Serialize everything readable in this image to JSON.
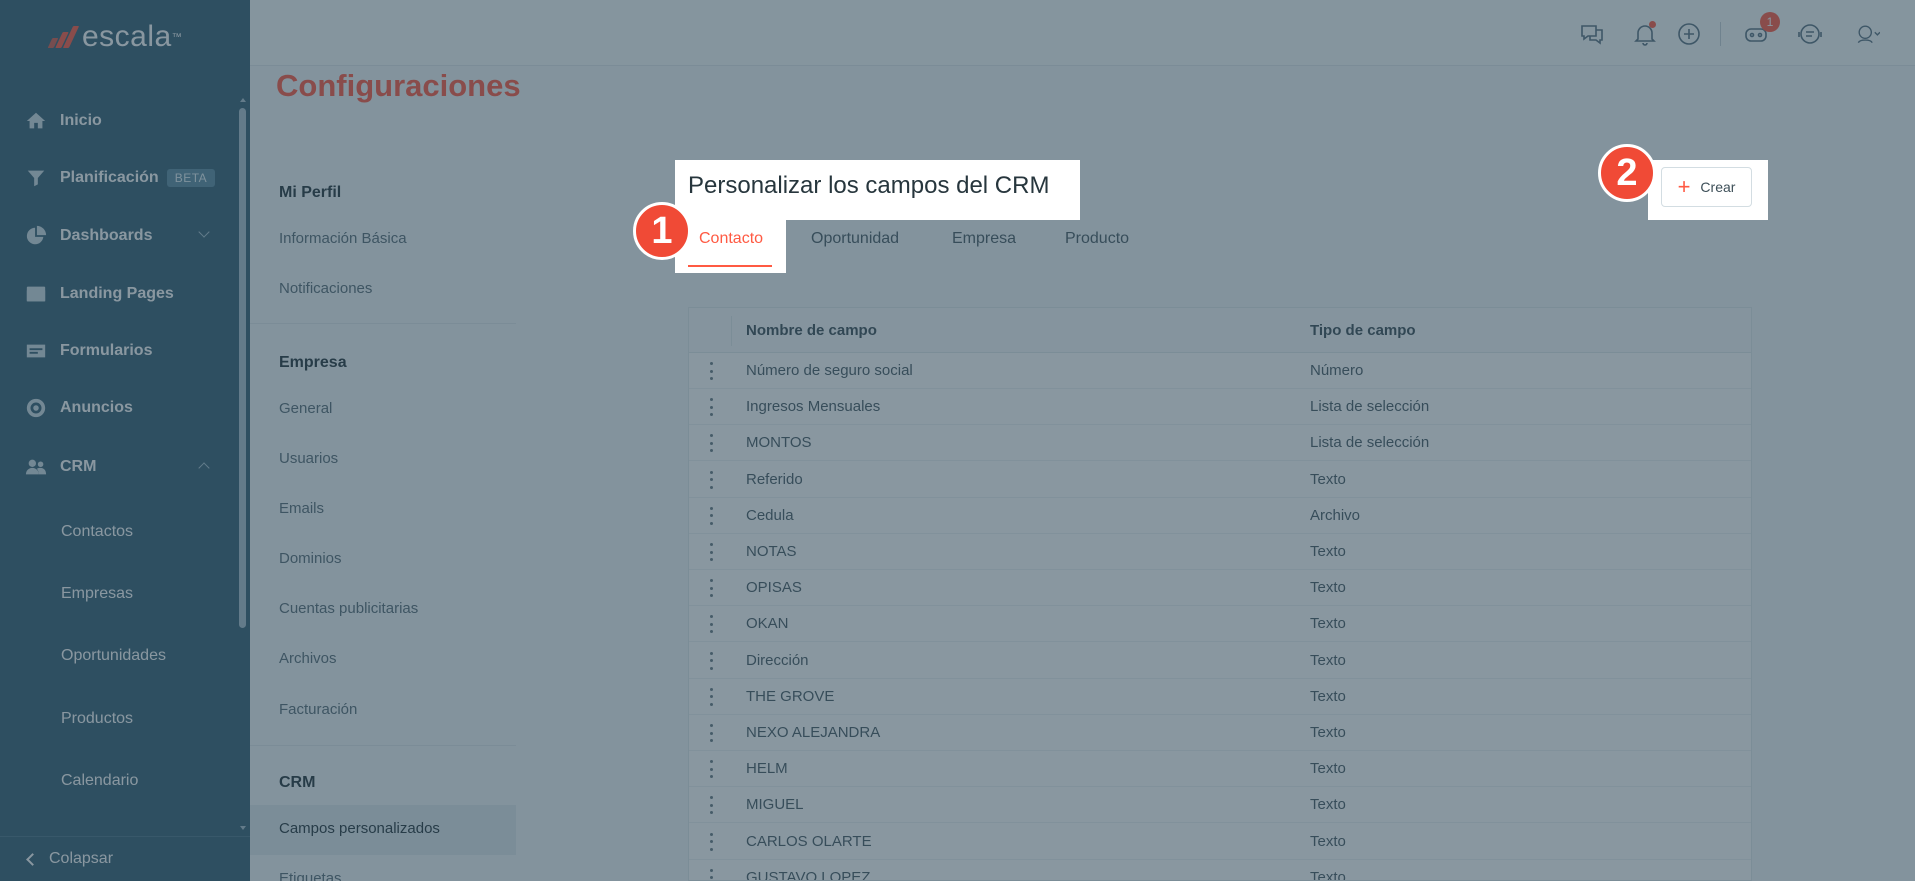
{
  "brand": {
    "name": "escala",
    "tm": "™"
  },
  "sidebar": {
    "items": [
      {
        "label": "Inicio",
        "icon": "home-icon"
      },
      {
        "label": "Planificación",
        "icon": "funnel-icon",
        "badge": "BETA"
      },
      {
        "label": "Dashboards",
        "icon": "pie-chart-icon"
      },
      {
        "label": "Landing Pages",
        "icon": "browser-icon"
      },
      {
        "label": "Formularios",
        "icon": "form-icon"
      },
      {
        "label": "Anuncios",
        "icon": "target-icon"
      },
      {
        "label": "CRM",
        "icon": "users-icon"
      }
    ],
    "crm_sub": [
      "Contactos",
      "Empresas",
      "Oportunidades",
      "Productos",
      "Calendario"
    ],
    "collapse_label": "Colapsar"
  },
  "topbar": {
    "robot_count": "1"
  },
  "page": {
    "title": "Configuraciones"
  },
  "settings_menu": {
    "profile_title": "Mi Perfil",
    "profile_items": [
      "Información Básica",
      "Notificaciones"
    ],
    "company_title": "Empresa",
    "company_items": [
      "General",
      "Usuarios",
      "Emails",
      "Dominios",
      "Cuentas publicitarias",
      "Archivos",
      "Facturación"
    ],
    "crm_title": "CRM",
    "crm_items": [
      "Campos personalizados",
      "Etiquetas"
    ]
  },
  "card": {
    "title": "Personalizar los campos del CRM",
    "tabs": [
      "Contacto",
      "Oportunidad",
      "Empresa",
      "Producto"
    ],
    "create_label": "Crear"
  },
  "table": {
    "headers": [
      "Nombre de campo",
      "Tipo de campo"
    ],
    "rows": [
      [
        "Número de seguro social",
        "Número"
      ],
      [
        "Ingresos Mensuales",
        "Lista de selección"
      ],
      [
        "MONTOS",
        "Lista de selección"
      ],
      [
        "Referido",
        "Texto"
      ],
      [
        "Cedula",
        "Archivo"
      ],
      [
        "NOTAS",
        "Texto"
      ],
      [
        "OPISAS",
        "Texto"
      ],
      [
        "OKAN",
        "Texto"
      ],
      [
        "Dirección",
        "Texto"
      ],
      [
        "THE GROVE",
        "Texto"
      ],
      [
        "NEXO ALEJANDRA",
        "Texto"
      ],
      [
        "HELM",
        "Texto"
      ],
      [
        "MIGUEL",
        "Texto"
      ],
      [
        "CARLOS OLARTE",
        "Texto"
      ],
      [
        "GUSTAVO LOPEZ",
        "Texto"
      ]
    ]
  },
  "annotations": {
    "step1": "1",
    "step2": "2"
  },
  "colors": {
    "accent": "#ff5a43",
    "sidebar": "#365f74",
    "overlay": "rgba(40,66,82,0.55)"
  }
}
